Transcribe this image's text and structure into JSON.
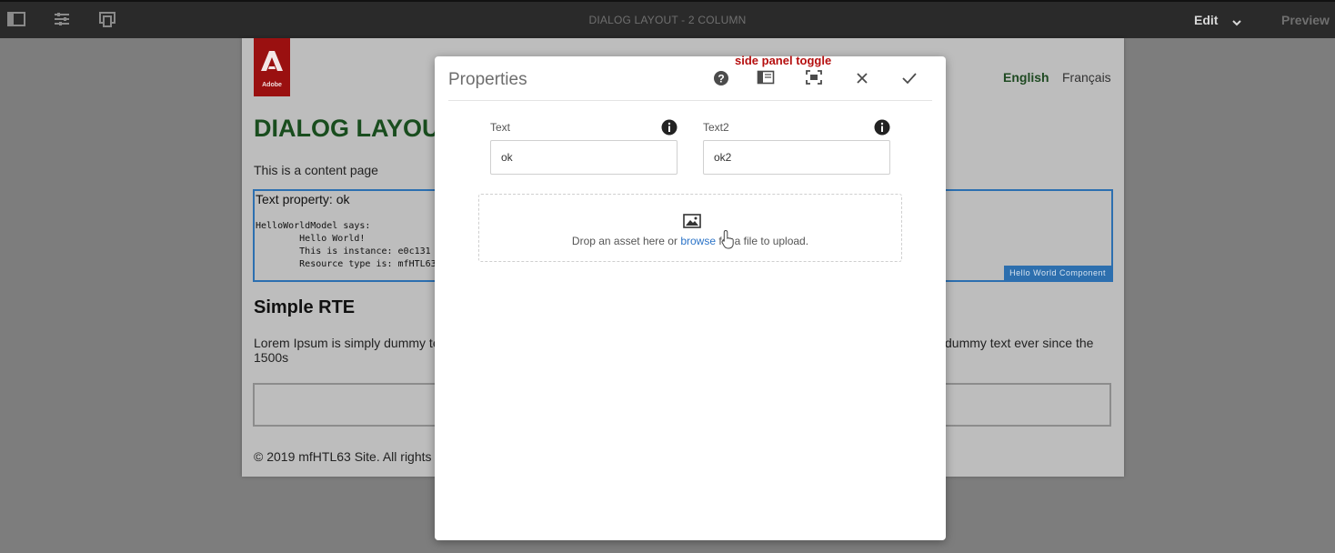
{
  "toolbar": {
    "title": "DIALOG LAYOUT - 2 COLUMN",
    "edit_label": "Edit",
    "preview_label": "Preview",
    "icons": [
      "side-panel-toggle-icon",
      "page-properties-icon",
      "emulator-icon",
      "chevron-down-icon"
    ]
  },
  "page": {
    "logo_text": "Adobe",
    "languages": [
      "English",
      "Français"
    ],
    "title": "DIALOG LAYOU",
    "content_text": "This is a content page",
    "hello_world": {
      "text_property": "Text property: ok",
      "code": "HelloWorldModel says:\n        Hello World!\n        This is instance: e0c131\n        Resource type is: mfHTL63",
      "badge": "Hello World Component"
    },
    "rte_title": "Simple RTE",
    "lorem_left_1": "Lorem Ipsum is simply dummy te",
    "lorem_left_2": "1500s",
    "lorem_right": "dummy text ever since the",
    "footer": "© 2019 mfHTL63 Site. All rights"
  },
  "dialog": {
    "title": "Properties",
    "annotation": "side panel toggle",
    "buttons": [
      "help-icon",
      "side-panel-toggle-icon",
      "fullscreen-icon",
      "close-icon",
      "done-check-icon"
    ],
    "fields": [
      {
        "label": "Text",
        "value": "ok"
      },
      {
        "label": "Text2",
        "value": "ok2"
      }
    ],
    "dropzone": {
      "text_before": "Drop an asset here or ",
      "link": "browse",
      "text_after": " for a file to upload."
    }
  },
  "colors": {
    "topbar": "#2a2a2a",
    "page_title": "#194d1e",
    "component_border": "#2c6fb0",
    "annotation": "#b50f0f",
    "logo": "#9a1010"
  }
}
